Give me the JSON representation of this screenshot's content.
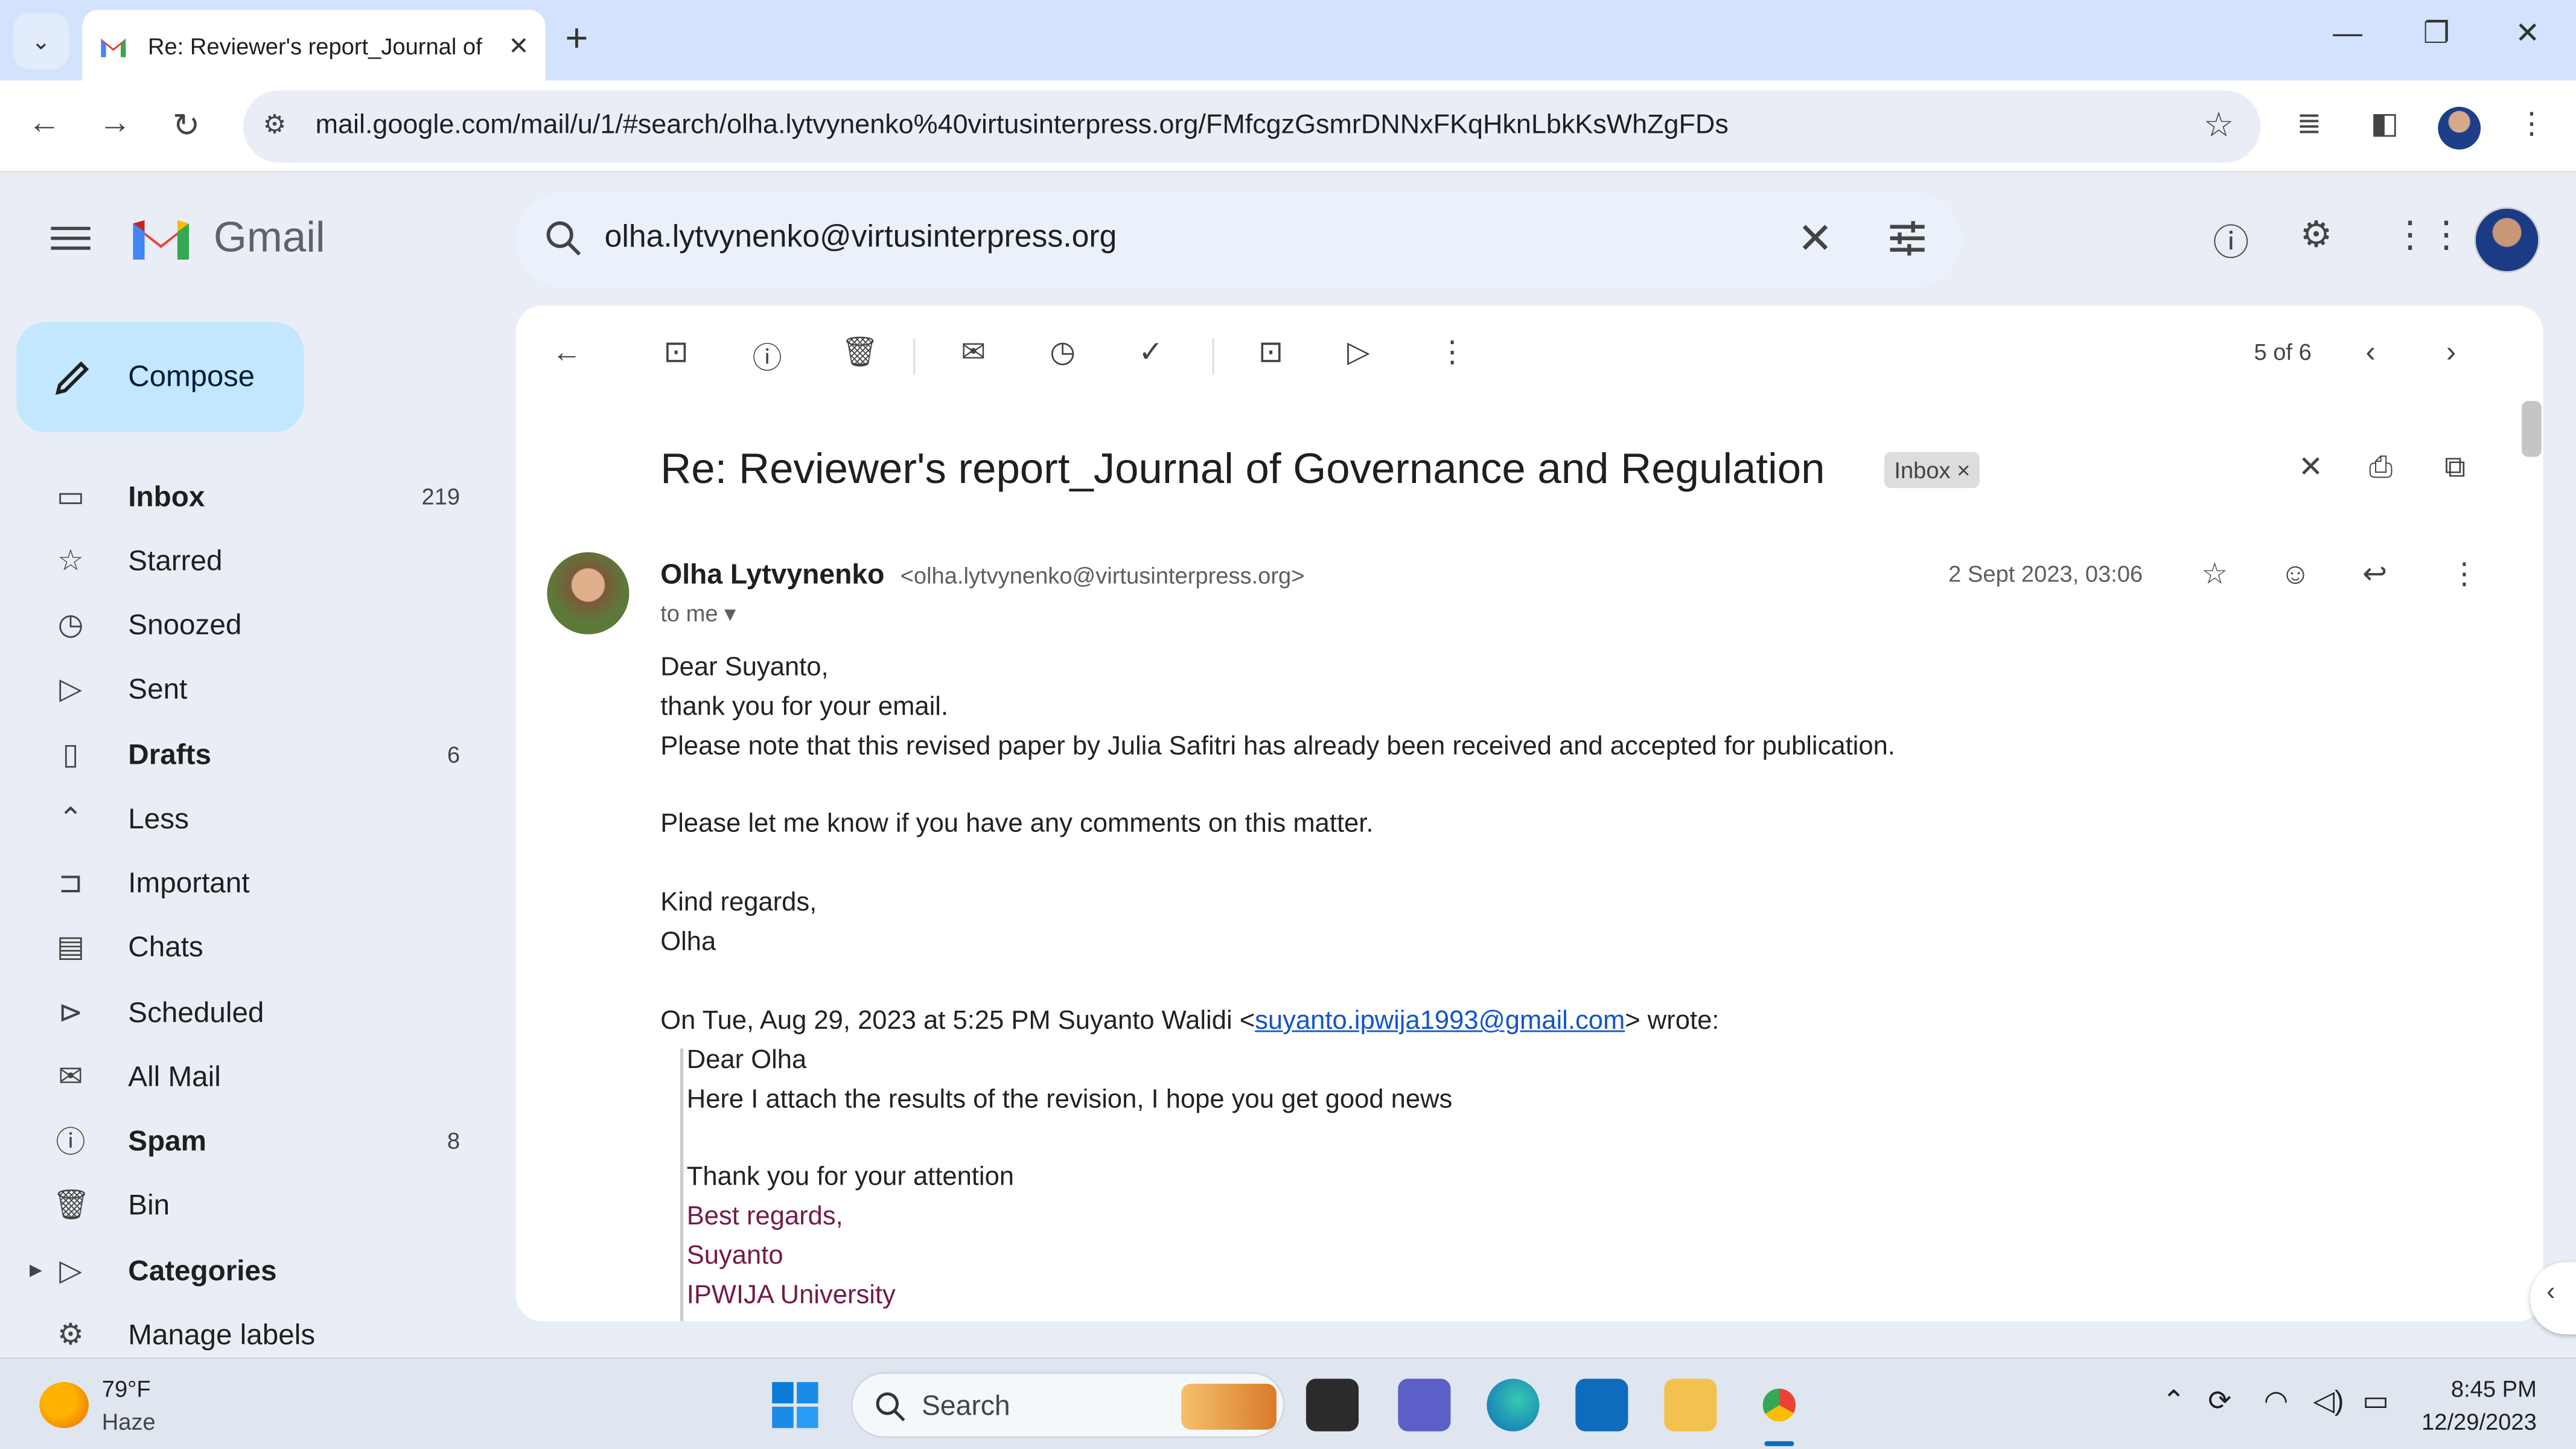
{
  "browser": {
    "tab_title": "Re: Reviewer's report_Journal of",
    "url": "mail.google.com/mail/u/1/#search/olha.lytvynenko%40virtusinterpress.org/FMfcgzGsmrDNNxFKqHknLbkKsWhZgFDs"
  },
  "gmail": {
    "brand": "Gmail",
    "search_query": "olha.lytvynenko@virtusinterpress.org"
  },
  "sidebar": {
    "compose_label": "Compose",
    "items": [
      {
        "label": "Inbox",
        "count": "219",
        "icon": "inbox-icon"
      },
      {
        "label": "Starred",
        "count": "",
        "icon": "star-icon"
      },
      {
        "label": "Snoozed",
        "count": "",
        "icon": "clock-icon"
      },
      {
        "label": "Sent",
        "count": "",
        "icon": "send-icon"
      },
      {
        "label": "Drafts",
        "count": "6",
        "icon": "draft-icon"
      },
      {
        "label": "Less",
        "count": "",
        "icon": "chevron-up-icon"
      },
      {
        "label": "Important",
        "count": "",
        "icon": "important-icon"
      },
      {
        "label": "Chats",
        "count": "",
        "icon": "chat-icon"
      },
      {
        "label": "Scheduled",
        "count": "",
        "icon": "scheduled-icon"
      },
      {
        "label": "All Mail",
        "count": "",
        "icon": "all-mail-icon"
      },
      {
        "label": "Spam",
        "count": "8",
        "icon": "spam-icon"
      },
      {
        "label": "Bin",
        "count": "",
        "icon": "trash-icon"
      },
      {
        "label": "Categories",
        "count": "",
        "icon": "label-icon"
      },
      {
        "label": "Manage labels",
        "count": "",
        "icon": "gear-icon"
      }
    ]
  },
  "message": {
    "pager": "5 of 6",
    "subject": "Re: Reviewer's report_Journal of Governance and Regulation",
    "label_chip": "Inbox",
    "sender_name": "Olha Lytvynenko",
    "sender_email": "<olha.lytvynenko@virtusinterpress.org>",
    "to_me": "to me",
    "date": "2 Sept 2023, 03:06",
    "body": [
      "Dear Suyanto,",
      "thank you for your email.",
      "Please note that this revised paper by Julia Safitri has already been received and accepted for publication.",
      "Please let me know if you have any comments on this matter.",
      "Kind regards,",
      "Olha"
    ],
    "quote_intro_pre": "On Tue, Aug 29, 2023 at 5:25 PM Suyanto Walidi <",
    "quote_link": "suyanto.ipwija1993@gmail.com",
    "quote_intro_post": "> wrote:",
    "quote": [
      "Dear Olha",
      "Here I attach the results of the revision, I hope you get good news",
      "Thank you for your attention",
      "Best regards,",
      "Suyanto",
      "IPWIJA University"
    ]
  },
  "taskbar": {
    "temperature": "79°F",
    "condition": "Haze",
    "search_label": "Search",
    "time": "8:45 PM",
    "date": "12/29/2023"
  }
}
